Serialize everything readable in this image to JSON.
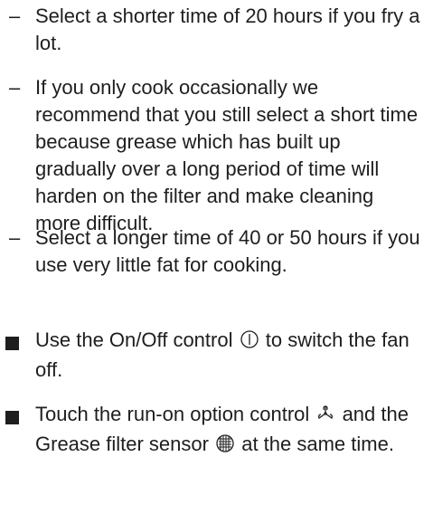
{
  "instructions": {
    "item1": {
      "marker": "–",
      "text": "Select a shorter time of 20 hours if you fry a lot."
    },
    "item2": {
      "marker": "–",
      "text": "If you only cook occasionally we recommend that you still select a short time because grease which has built up gradually over a long period of time will harden on the filter and make cleaning more difficult."
    },
    "item3": {
      "marker": "–",
      "text": "Select a longer time of 40 or 50 hours if you use very little fat for cooking."
    },
    "step1": {
      "before_icon": "Use the On/Off control",
      "icon": "power-icon",
      "after_icon": "to switch the fan off."
    },
    "step2": {
      "part1": "Touch the run-on option control",
      "icon1": "fan-runon-icon",
      "part2": "and the Grease filter sensor",
      "icon2": "grease-filter-icon",
      "part3": "at the same time."
    }
  }
}
